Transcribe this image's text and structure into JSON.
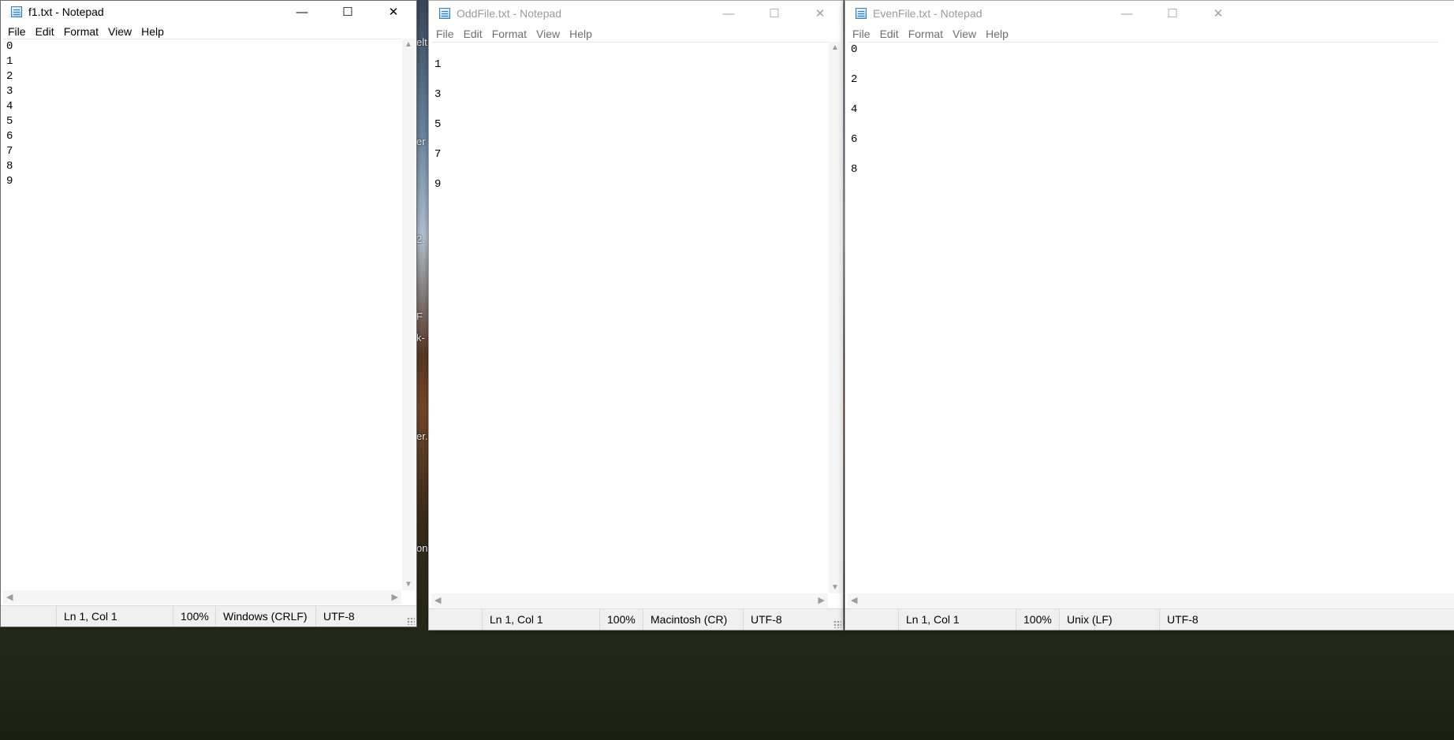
{
  "windows": [
    {
      "title": "f1.txt - Notepad",
      "menu": [
        "File",
        "Edit",
        "Format",
        "View",
        "Help"
      ],
      "lines": [
        "0",
        "1",
        "2",
        "3",
        "4",
        "5",
        "6",
        "7",
        "8",
        "9"
      ],
      "status": {
        "position": "Ln 1, Col 1",
        "zoom": "100%",
        "line_ending": "Windows (CRLF)",
        "encoding": "UTF-8"
      },
      "controls": {
        "minimize": "—",
        "maximize": "☐",
        "close": "✕"
      }
    },
    {
      "title": "OddFile.txt - Notepad",
      "menu": [
        "File",
        "Edit",
        "Format",
        "View",
        "Help"
      ],
      "lines": [
        "",
        "1",
        "",
        "3",
        "",
        "5",
        "",
        "7",
        "",
        "9"
      ],
      "status": {
        "position": "Ln 1, Col 1",
        "zoom": "100%",
        "line_ending": "Macintosh (CR)",
        "encoding": "UTF-8"
      },
      "controls": {
        "minimize": "—",
        "maximize": "☐",
        "close": "✕"
      }
    },
    {
      "title": "EvenFile.txt - Notepad",
      "menu": [
        "File",
        "Edit",
        "Format",
        "View",
        "Help"
      ],
      "lines": [
        "0",
        "",
        "2",
        "",
        "4",
        "",
        "6",
        "",
        "8"
      ],
      "status": {
        "position": "Ln 1, Col 1",
        "zoom": "100%",
        "line_ending": "Unix (LF)",
        "encoding": "UTF-8"
      },
      "controls": {
        "minimize": "—",
        "maximize": "☐",
        "close": "✕"
      }
    }
  ],
  "desktop_fragments": [
    "elt",
    "er",
    "2.",
    "F",
    "k-",
    "er.",
    "ong"
  ],
  "scroll_glyphs": {
    "up": "▲",
    "down": "▼",
    "left": "◀",
    "right": "▶"
  }
}
